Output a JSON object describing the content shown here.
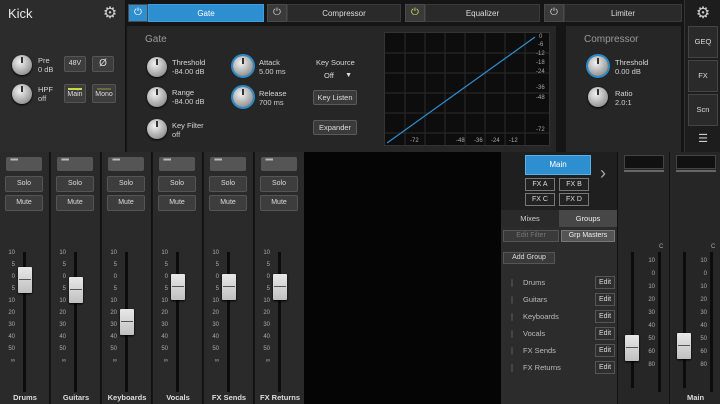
{
  "channel": {
    "name": "Kick",
    "pre_label": "Pre",
    "pre_value": "0 dB",
    "hpf_label": "HPF",
    "hpf_value": "off",
    "btn_48v": "48V",
    "btn_phase": "Ø",
    "btn_main": "Main",
    "btn_mono": "Mono"
  },
  "tabs": [
    {
      "label": "Gate"
    },
    {
      "label": "Compressor"
    },
    {
      "label": "Equalizer"
    },
    {
      "label": "Limiter"
    }
  ],
  "gate": {
    "title": "Gate",
    "threshold_label": "Threshold",
    "threshold_value": "-84.00 dB",
    "range_label": "Range",
    "range_value": "-84.00 dB",
    "key_filter_label": "Key Filter",
    "key_filter_value": "off",
    "attack_label": "Attack",
    "attack_value": "5.00 ms",
    "release_label": "Release",
    "release_value": "700 ms",
    "key_source_label": "Key Source",
    "key_source_value": "Off",
    "key_listen": "Key Listen",
    "expander": "Expander",
    "graph_y_ticks": [
      "0",
      "-6",
      "-12",
      "-18",
      "-24",
      "-36",
      "-48",
      "-72"
    ],
    "graph_x_ticks": [
      "-72",
      "-48",
      "-36",
      "-24",
      "-12"
    ]
  },
  "compressor": {
    "title": "Compressor",
    "threshold_label": "Threshold",
    "threshold_value": "0.00 dB",
    "ratio_label": "Ratio",
    "ratio_value": "2.0:1"
  },
  "side_nav": {
    "geq": "GEQ",
    "fx": "FX",
    "scn": "Scn",
    "menu_icon": "list-icon"
  },
  "mixer": {
    "solo": "Solo",
    "mute": "Mute",
    "scale": [
      "10",
      "5",
      "0",
      "5",
      "10",
      "20",
      "30",
      "40",
      "50",
      "∞"
    ],
    "channels": [
      {
        "name": "Drums",
        "level": 0.8
      },
      {
        "name": "Guitars",
        "level": 0.73
      },
      {
        "name": "Keyboards",
        "level": 0.5
      },
      {
        "name": "Vocals",
        "level": 0.75
      },
      {
        "name": "FX Sends",
        "level": 0.75
      },
      {
        "name": "FX Returns",
        "level": 0.75
      }
    ]
  },
  "groups_panel": {
    "main": "Main",
    "fx_buttons": [
      "FX A",
      "FX B",
      "FX C",
      "FX D"
    ],
    "tab_mixes": "Mixes",
    "tab_groups": "Groups",
    "edit_filter": "Edit Filter",
    "grp_masters": "Grp Masters",
    "add_group": "Add Group",
    "edit_label": "Edit",
    "groups": [
      "Drums",
      "Guitars",
      "Keyboards",
      "Vocals",
      "FX Sends",
      "FX Returns"
    ]
  },
  "masters": {
    "main_label": "Main",
    "scale": [
      "C",
      "10",
      "0",
      "10",
      "20",
      "30",
      "40",
      "50",
      "60",
      "80"
    ]
  },
  "colors": {
    "accent": "#2e8fd0",
    "led": "#c8d84a"
  }
}
